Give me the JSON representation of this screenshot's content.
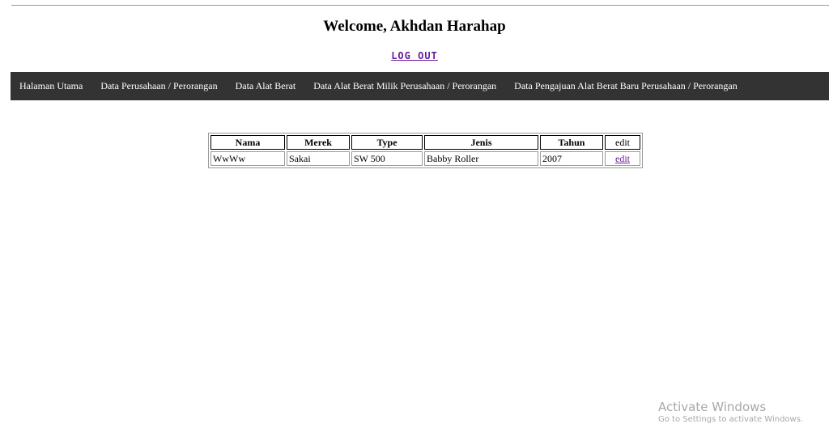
{
  "header": {
    "welcome": "Welcome, Akhdan Harahap",
    "logout_label": "LOG OUT"
  },
  "nav": {
    "items": [
      {
        "label": "Halaman Utama"
      },
      {
        "label": "Data Perusahaan / Perorangan"
      },
      {
        "label": "Data Alat Berat"
      },
      {
        "label": "Data Alat Berat Milik Perusahaan / Perorangan"
      },
      {
        "label": "Data Pengajuan Alat Berat Baru Perusahaan / Perorangan"
      }
    ]
  },
  "table": {
    "columns": [
      "Nama",
      "Merek",
      "Type",
      "Jenis",
      "Tahun",
      "edit"
    ],
    "rows": [
      {
        "nama": "WwWw",
        "merek": "Sakai",
        "type": "SW 500",
        "jenis": "Babby Roller",
        "tahun": "2007",
        "edit": "edit"
      }
    ]
  },
  "watermark": {
    "title": "Activate Windows",
    "subtitle": "Go to Settings to activate Windows."
  },
  "colors": {
    "navbar_bg": "#333333",
    "link": "#6a1b9a"
  }
}
